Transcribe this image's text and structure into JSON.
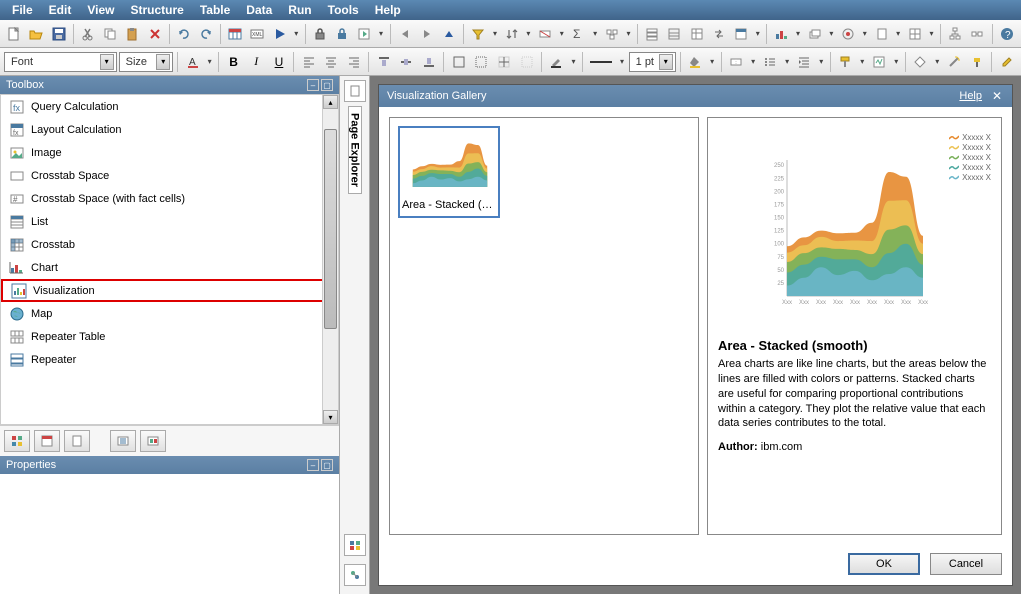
{
  "menus": [
    "File",
    "Edit",
    "View",
    "Structure",
    "Table",
    "Data",
    "Run",
    "Tools",
    "Help"
  ],
  "font_combo": {
    "label": "Font"
  },
  "size_combo": {
    "label": "Size"
  },
  "pt_combo": {
    "label": "1 pt"
  },
  "panels": {
    "toolbox_title": "Toolbox",
    "properties_title": "Properties",
    "page_explorer": "Page Explorer"
  },
  "toolbox": {
    "items": [
      {
        "label": "Query Calculation",
        "icon": "calc",
        "hl": false
      },
      {
        "label": "Layout Calculation",
        "icon": "layout-calc",
        "hl": false
      },
      {
        "label": "Image",
        "icon": "image",
        "hl": false
      },
      {
        "label": "Crosstab Space",
        "icon": "crosstab-space",
        "hl": false
      },
      {
        "label": "Crosstab Space (with fact cells)",
        "icon": "crosstab-space-fact",
        "hl": false
      },
      {
        "label": "List",
        "icon": "list",
        "hl": false
      },
      {
        "label": "Crosstab",
        "icon": "crosstab",
        "hl": false
      },
      {
        "label": "Chart",
        "icon": "chart",
        "hl": false
      },
      {
        "label": "Visualization",
        "icon": "visualization",
        "hl": true
      },
      {
        "label": "Map",
        "icon": "map",
        "hl": false
      },
      {
        "label": "Repeater Table",
        "icon": "repeater-table",
        "hl": false
      },
      {
        "label": "Repeater",
        "icon": "repeater",
        "hl": false
      }
    ]
  },
  "dialog": {
    "title": "Visualization Gallery",
    "help": "Help",
    "gallery_item_label": "Area - Stacked (smoo...",
    "detail_title": "Area - Stacked (smooth)",
    "detail_desc": "Area charts are like line charts, but the areas below the lines are filled with colors or patterns. Stacked charts are useful for comparing proportional contributions within a category. They plot the relative value that each data series contributes to the total.",
    "author_label": "Author:",
    "author_value": "ibm.com",
    "ok": "OK",
    "cancel": "Cancel",
    "legend_items": [
      "Xxxxx X",
      "Xxxxx X",
      "Xxxxx X",
      "Xxxxx X",
      "Xxxxx X"
    ],
    "legend_colors": [
      "#e68a2e",
      "#ecc255",
      "#79b05a",
      "#4ca8a0",
      "#6bb6c9"
    ]
  },
  "chart_data": {
    "type": "area",
    "stacked": true,
    "xlabel": "",
    "ylabel": "",
    "x_ticks": [
      "Xxx",
      "Xxx",
      "Xxx",
      "Xxx",
      "Xxx",
      "Xxx",
      "Xxx",
      "Xxx",
      "Xxx"
    ],
    "y_ticks": [
      "25",
      "50",
      "75",
      "100",
      "125",
      "150",
      "175",
      "200",
      "225",
      "250"
    ],
    "ylim": [
      0,
      260
    ],
    "series": [
      {
        "name": "Xxxxx X",
        "color": "#6bb6c9",
        "values": [
          20,
          35,
          55,
          40,
          48,
          30,
          42,
          55,
          35
        ]
      },
      {
        "name": "Xxxxx X",
        "color": "#4ca8a0",
        "values": [
          25,
          25,
          20,
          30,
          22,
          25,
          40,
          45,
          25
        ]
      },
      {
        "name": "Xxxxx X",
        "color": "#79b05a",
        "values": [
          20,
          22,
          18,
          20,
          18,
          25,
          45,
          35,
          20
        ]
      },
      {
        "name": "Xxxxx X",
        "color": "#ecc255",
        "values": [
          18,
          15,
          20,
          15,
          18,
          25,
          55,
          48,
          20
        ]
      },
      {
        "name": "Xxxxx X",
        "color": "#e68a2e",
        "values": [
          12,
          15,
          12,
          15,
          15,
          35,
          55,
          45,
          15
        ]
      }
    ]
  }
}
